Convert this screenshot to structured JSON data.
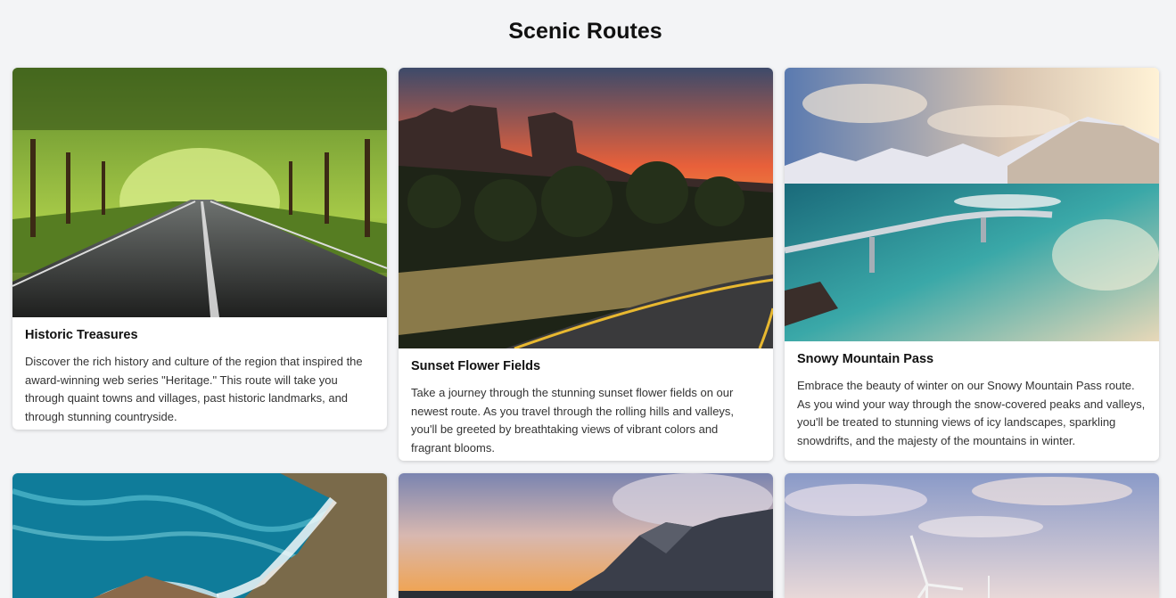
{
  "page": {
    "title": "Scenic Routes"
  },
  "cards": [
    {
      "title": "Historic Treasures",
      "description": "Discover the rich history and culture of the region that inspired the award-winning web series \"Heritage.\" This route will take you through quaint towns and villages, past historic landmarks, and through stunning countryside.",
      "image": "tree-lined-road-photo"
    },
    {
      "title": "Sunset Flower Fields",
      "description": "Take a journey through the stunning sunset flower fields on our newest route. As you travel through the rolling hills and valleys, you'll be greeted by breathtaking views of vibrant colors and fragrant blooms.",
      "image": "desert-sunset-road-photo"
    },
    {
      "title": "Snowy Mountain Pass",
      "description": "Embrace the beauty of winter on our Snowy Mountain Pass route. As you wind your way through the snow-covered peaks and valleys, you'll be treated to stunning views of icy landscapes, sparkling snowdrifts, and the majesty of the mountains in winter.",
      "image": "mountain-bridge-photo"
    },
    {
      "title": "",
      "description": "",
      "image": "coastline-aerial-photo"
    },
    {
      "title": "",
      "description": "",
      "image": "misty-mountain-sunset-photo"
    },
    {
      "title": "",
      "description": "",
      "image": "wind-turbine-sky-photo"
    }
  ],
  "colors": {
    "background": "#f3f4f6",
    "card": "#ffffff",
    "title_text": "#111111",
    "body_text": "#333333"
  }
}
